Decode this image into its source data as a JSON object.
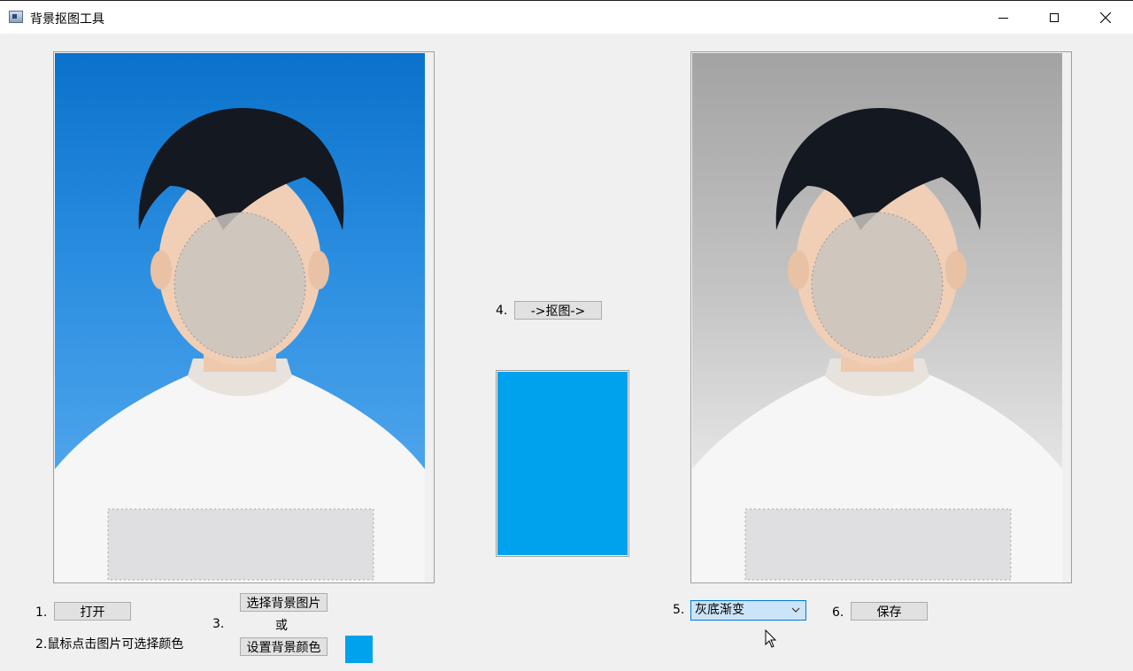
{
  "window": {
    "title": "背景抠图工具",
    "icons": {
      "app": "app-icon",
      "minimize": "minimize-icon",
      "maximize": "maximize-icon",
      "close": "close-icon"
    }
  },
  "images": {
    "original": {
      "background_color": "#0a72cc",
      "subject": "portrait-person"
    },
    "result": {
      "background_style": "gray-gradient",
      "subject": "portrait-person"
    }
  },
  "steps": {
    "step1": {
      "number": "1.",
      "open_label": "打开"
    },
    "step2": {
      "text": "2.鼠标点击图片可选择颜色"
    },
    "step3": {
      "number": "3.",
      "select_bg_image_label": "选择背景图片",
      "or_text": "或",
      "set_bg_color_label": "设置背景颜色",
      "swatch_color": "#00a2ed"
    },
    "step4": {
      "number": "4.",
      "cutout_label": "->抠图->",
      "preview_color": "#00a2ed"
    },
    "step5": {
      "number": "5.",
      "selected_style": "灰底渐变",
      "icon": "chevron-down-icon"
    },
    "step6": {
      "number": "6.",
      "save_label": "保存"
    }
  }
}
